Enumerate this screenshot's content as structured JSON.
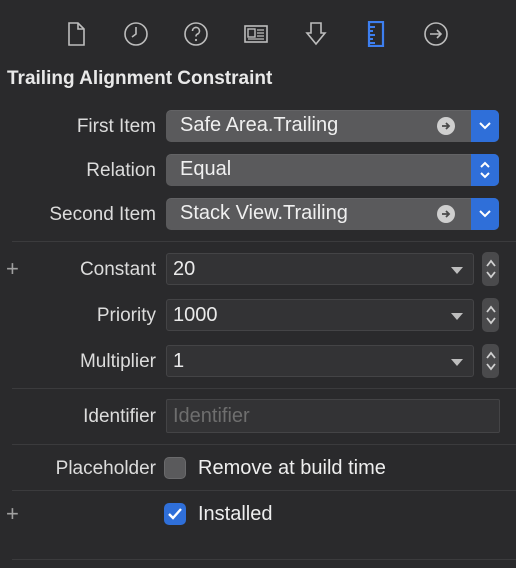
{
  "toolbar": {
    "icons": [
      {
        "name": "file-inspector-icon"
      },
      {
        "name": "history-inspector-icon"
      },
      {
        "name": "quick-help-icon"
      },
      {
        "name": "identity-inspector-icon"
      },
      {
        "name": "attributes-inspector-icon"
      },
      {
        "name": "size-inspector-icon",
        "selected": true
      },
      {
        "name": "connections-inspector-icon"
      }
    ],
    "accent": "#2f6fd9"
  },
  "section_title": "Trailing Alignment Constraint",
  "first_item": {
    "label": "First Item",
    "value": "Safe Area.Trailing"
  },
  "relation": {
    "label": "Relation",
    "value": "Equal"
  },
  "second_item": {
    "label": "Second Item",
    "value": "Stack View.Trailing"
  },
  "constant": {
    "label": "Constant",
    "value": "20"
  },
  "priority": {
    "label": "Priority",
    "value": "1000"
  },
  "multiplier": {
    "label": "Multiplier",
    "value": "1"
  },
  "identifier": {
    "label": "Identifier",
    "placeholder": "Identifier",
    "value": ""
  },
  "placeholder": {
    "label": "Placeholder",
    "checkbox_label": "Remove at build time",
    "checked": false
  },
  "installed": {
    "checkbox_label": "Installed",
    "checked": true
  },
  "plus_symbol": "+"
}
